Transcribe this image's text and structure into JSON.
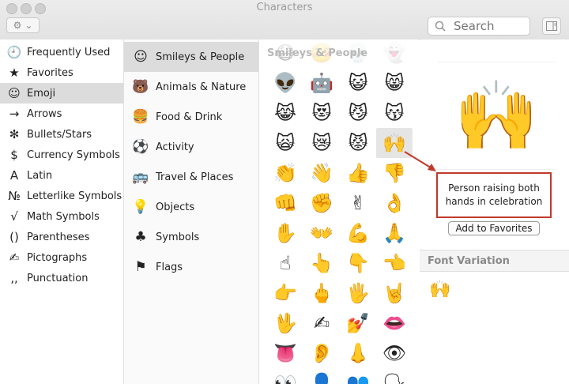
{
  "window": {
    "title": "Characters"
  },
  "toolbar": {
    "gear_chevron": "⌄",
    "search_placeholder": "Search"
  },
  "categories": [
    {
      "icon": "clock-icon",
      "glyph": "🕘",
      "label": "Frequently Used"
    },
    {
      "icon": "star-icon",
      "glyph": "★",
      "label": "Favorites"
    },
    {
      "icon": "smiley-icon",
      "glyph": "☺",
      "label": "Emoji",
      "selected": true
    },
    {
      "icon": "arrow-icon",
      "glyph": "→",
      "label": "Arrows"
    },
    {
      "icon": "asterisk-icon",
      "glyph": "✻",
      "label": "Bullets/Stars"
    },
    {
      "icon": "dollar-icon",
      "glyph": "$",
      "label": "Currency Symbols"
    },
    {
      "icon": "latin-a-icon",
      "glyph": "A",
      "label": "Latin"
    },
    {
      "icon": "numero-icon",
      "glyph": "№",
      "label": "Letterlike Symbols"
    },
    {
      "icon": "sqrt-icon",
      "glyph": "√",
      "label": "Math Symbols"
    },
    {
      "icon": "parentheses-icon",
      "glyph": "()",
      "label": "Parentheses"
    },
    {
      "icon": "pictograph-icon",
      "glyph": "✍",
      "label": "Pictographs"
    },
    {
      "icon": "punctuation-icon",
      "glyph": "‚,",
      "label": "Punctuation"
    }
  ],
  "subcategories": [
    {
      "icon": "smiley-face-icon",
      "glyph": "☺",
      "label": "Smileys & People",
      "selected": true
    },
    {
      "icon": "bear-icon",
      "glyph": "🐻",
      "label": "Animals & Nature"
    },
    {
      "icon": "food-icon",
      "glyph": "🍔",
      "label": "Food & Drink"
    },
    {
      "icon": "soccer-ball-icon",
      "glyph": "⚽",
      "label": "Activity"
    },
    {
      "icon": "bus-icon",
      "glyph": "🚌",
      "label": "Travel & Places"
    },
    {
      "icon": "lightbulb-icon",
      "glyph": "💡",
      "label": "Objects"
    },
    {
      "icon": "symbols-icon",
      "glyph": "♣",
      "label": "Symbols"
    },
    {
      "icon": "flag-icon",
      "glyph": "⚑",
      "label": "Flags"
    }
  ],
  "grid": {
    "header": "Smileys & People",
    "emojis": [
      "😷",
      "🤒",
      "💀",
      "👻",
      "👽",
      "🤖",
      "😺",
      "😸",
      "😹",
      "😻",
      "😼",
      "😽",
      "🙀",
      "😿",
      "😾",
      "🙌",
      "👏",
      "👋",
      "👍",
      "👎",
      "👊",
      "✊",
      "✌",
      "👌",
      "✋",
      "👐",
      "💪",
      "🙏",
      "☝",
      "👆",
      "👇",
      "👈",
      "👉",
      "🖕",
      "🖐",
      "🤘",
      "🖖",
      "✍",
      "💅",
      "👄",
      "👅",
      "👂",
      "👃",
      "👁",
      "👀",
      "👤",
      "👥",
      "🗣"
    ],
    "selected_index": 15
  },
  "detail": {
    "preview": "🙌",
    "add_favorites": "Add to Favorites",
    "font_variation_header": "Font Variation",
    "variant": "🙌"
  },
  "callout": {
    "text": "Person raising both hands in celebration",
    "border_color": "#c0392b"
  }
}
